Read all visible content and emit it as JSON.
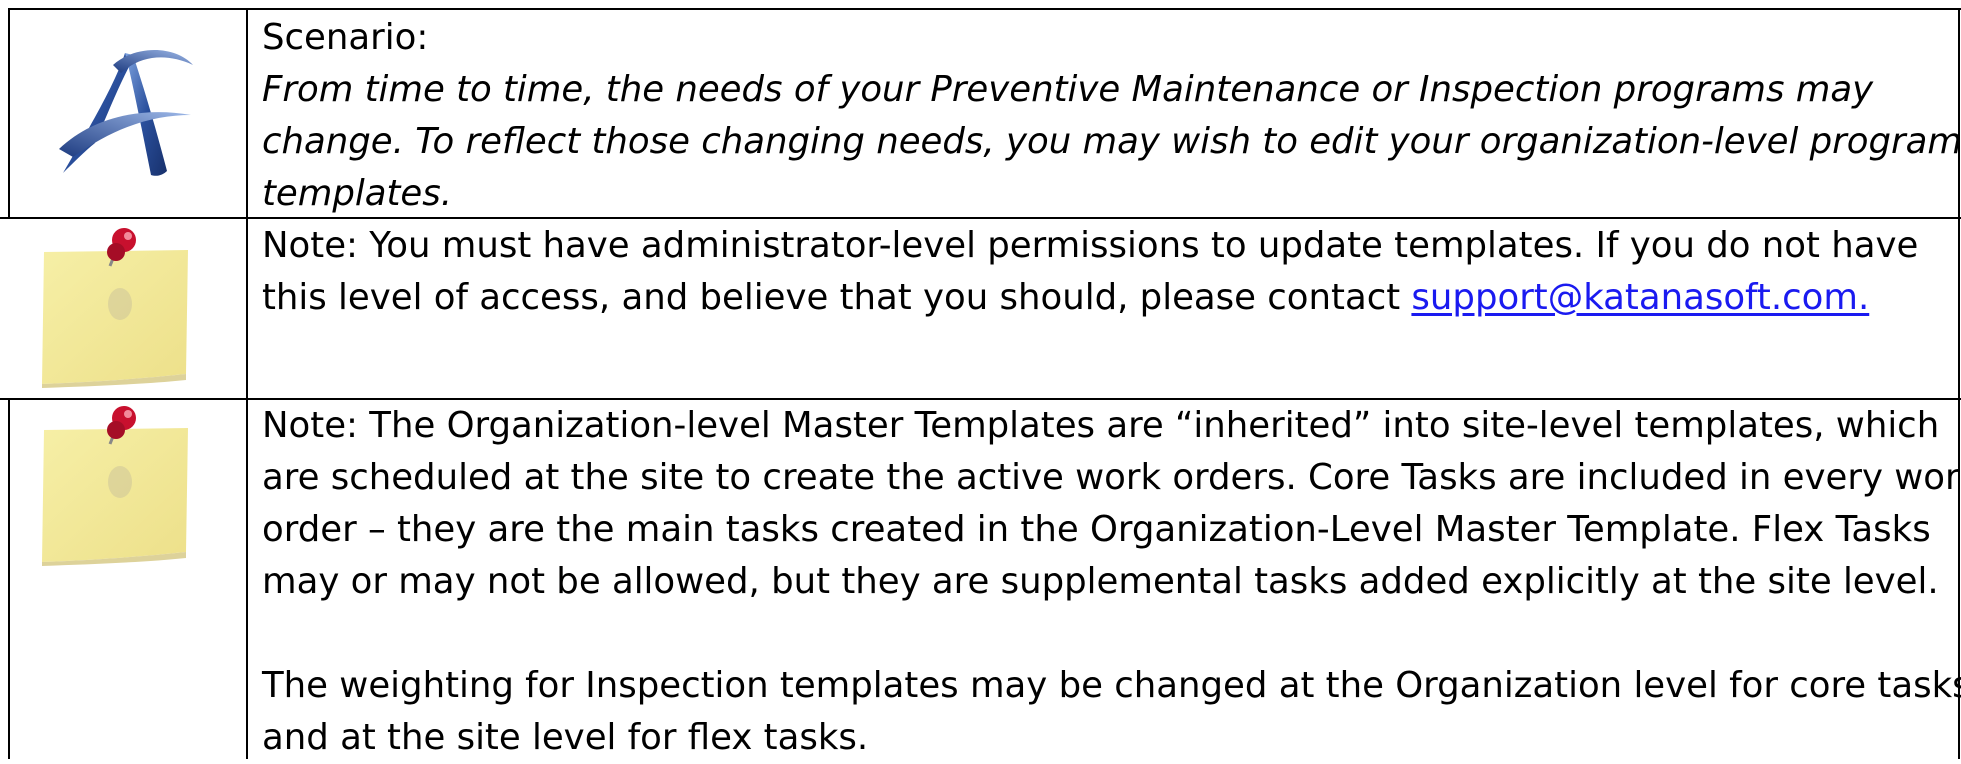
{
  "rows": [
    {
      "icon": "katana-logo-icon",
      "heading": "Scenario:",
      "lines": [
        "From time to time, the needs of your Preventive Maintenance or Inspection programs may",
        "change. To reflect those changing needs, you may wish to edit your organization-level program",
        "templates."
      ]
    },
    {
      "icon": "sticky-note-pin-icon",
      "line1": "Note: You must have administrator-level permissions to update templates. If you do not have",
      "line2_prefix": "this level of access, and believe that you should, please contact ",
      "link": "support@katanasoft.com."
    },
    {
      "icon": "sticky-note-pin-icon",
      "paragraph1": [
        "Note: The Organization-level Master Templates are “inherited” into site-level templates, which",
        "are scheduled at the site to create the active work orders. Core Tasks are included in every work",
        "order – they are the main tasks created in the Organization-Level Master Template. Flex Tasks",
        "may or may not be allowed, but they are supplemental tasks added explicitly at the site level."
      ],
      "paragraph2": [
        "The weighting for Inspection templates may be changed at the Organization level for core tasks,",
        "and at the site level for flex tasks."
      ]
    }
  ],
  "colors": {
    "link": "#1a1af0",
    "note_paper": "#f4ec9c",
    "pin": "#c8102e",
    "logo": "#2a4f9c"
  }
}
